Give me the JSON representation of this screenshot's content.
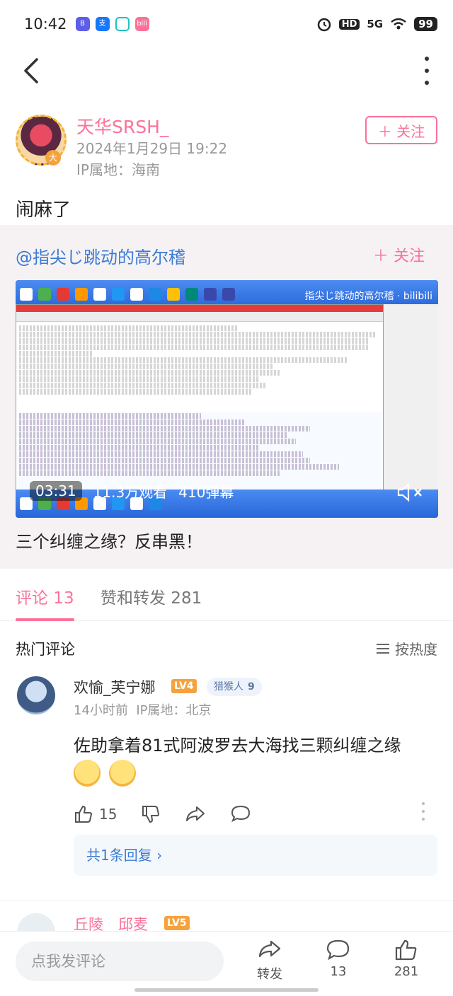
{
  "status_bar": {
    "time": "10:42",
    "network": "5G",
    "battery": "99"
  },
  "post": {
    "author": "天华SRSH_",
    "avatar_badge": "大",
    "timestamp": "2024年1月29日 19:22",
    "ip": "IP属地：海南",
    "follow_label": "＋ 关注",
    "text": "闹麻了"
  },
  "repost": {
    "author": "@指尖じ跳动的高尔稽",
    "follow_label": "＋ 关注",
    "video": {
      "duration": "03:31",
      "views": "11.3万观看",
      "danmaku": "410弹幕",
      "watermark": "指尖じ跳动的高尔稽 · bilibili"
    },
    "title": "三个纠缠之缘？反串黑！"
  },
  "tabs": [
    {
      "label": "评论 13"
    },
    {
      "label": "赞和转发 281"
    }
  ],
  "comments_section": {
    "title": "热门评论",
    "sort_label": "按热度"
  },
  "comments": [
    {
      "username": "欢愉_芙宁娜",
      "level": "LV4",
      "tag_label": "猎猴人",
      "tag_count": "9",
      "time": "14小时前",
      "ip": "IP属地：北京",
      "text": "佐助拿着81式阿波罗去大海找三颗纠缠之缘",
      "likes": "15",
      "replies_label": "共1条回复 ›"
    },
    {
      "username": "丘陵__邱麦",
      "level": "LV5"
    }
  ],
  "bottom_bar": {
    "input_placeholder": "点我发评论",
    "share_label": "转发",
    "comment_count": "13",
    "like_count": "281"
  },
  "colors": {
    "accent": "#fb7299",
    "link": "#3a7bd5"
  }
}
